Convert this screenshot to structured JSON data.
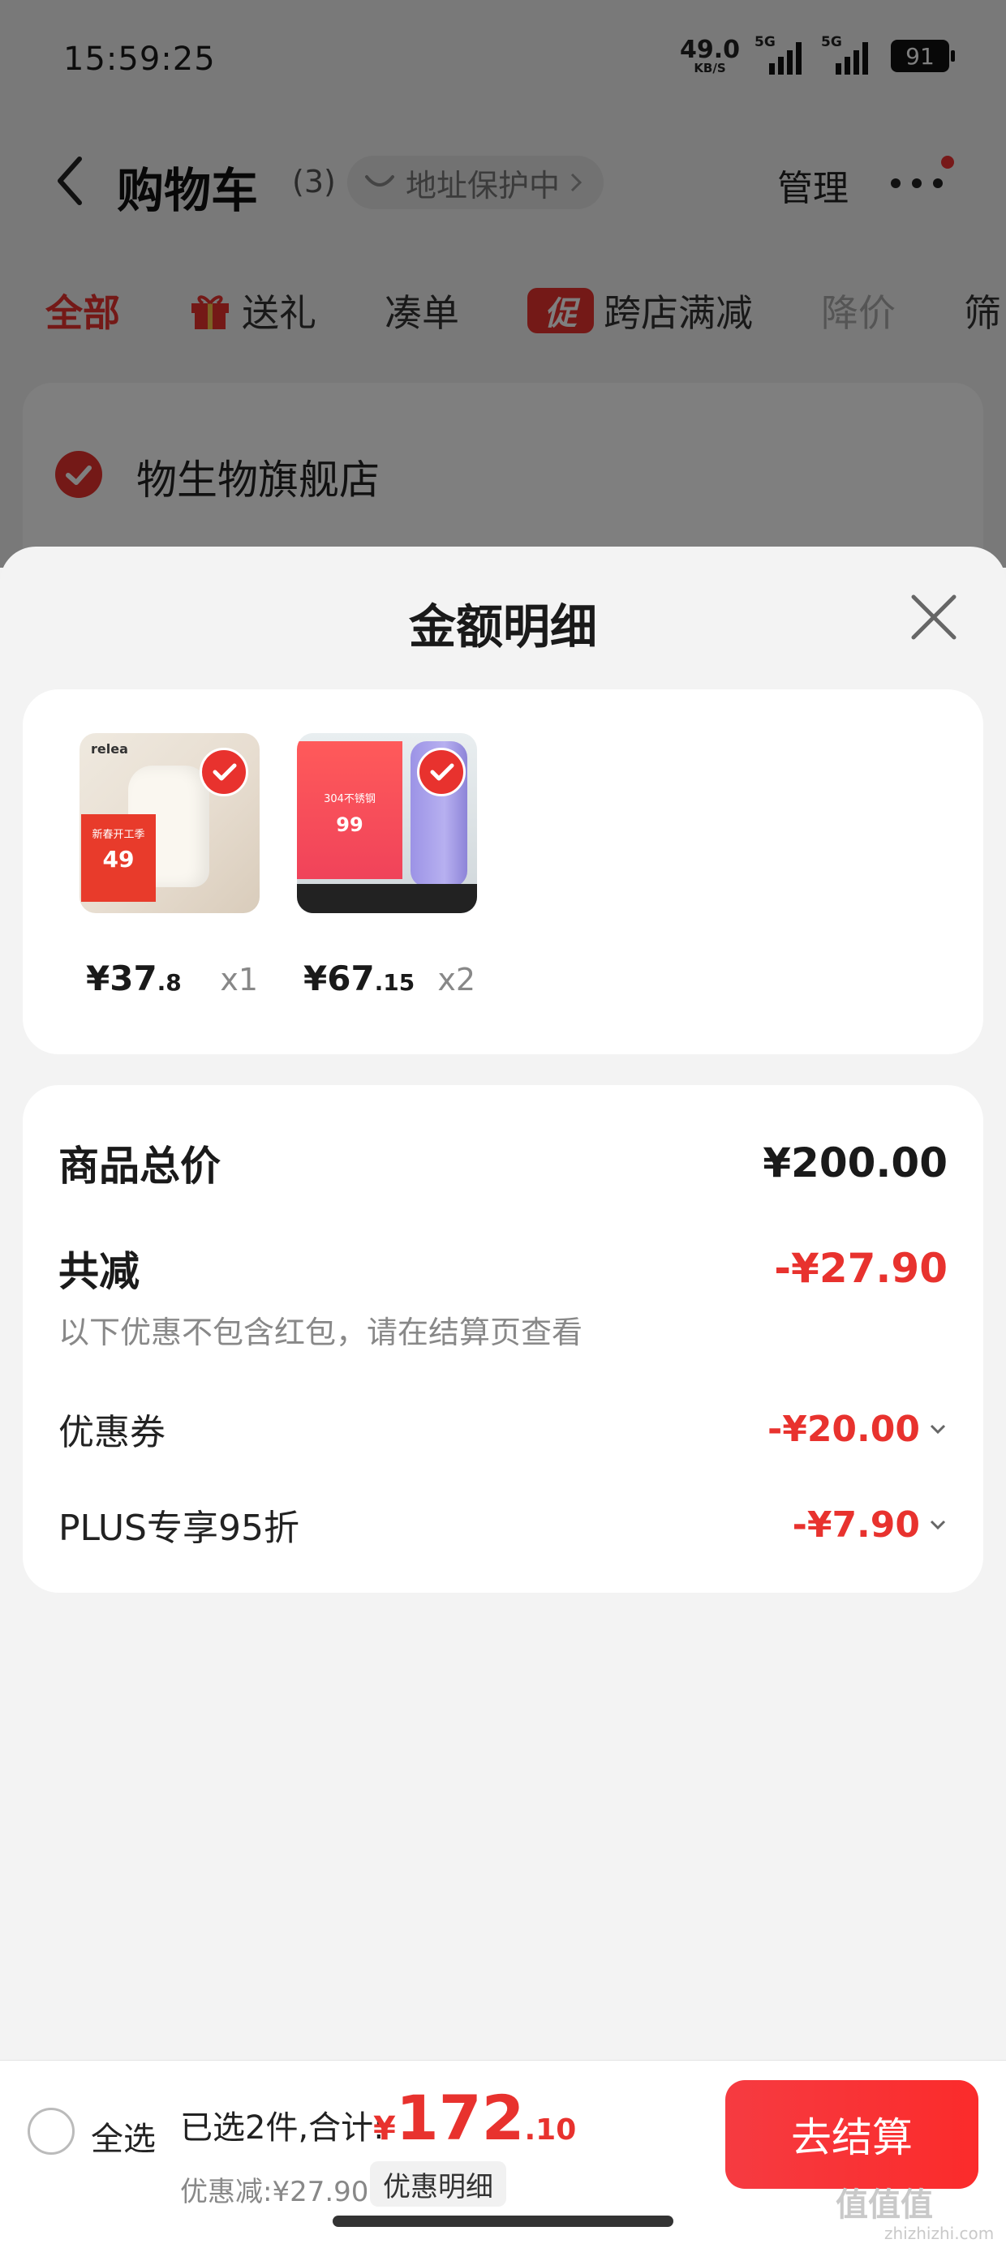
{
  "status_bar": {
    "time": "15:59:25",
    "net_speed": "49.0",
    "net_unit": "KB/S",
    "sim1": "5G",
    "sim2": "5G",
    "battery": "91"
  },
  "header": {
    "title": "购物车",
    "count": "(3)",
    "address_chip": "地址保护中",
    "manage": "管理"
  },
  "tabs": [
    "全部",
    "送礼",
    "凑单",
    "跨店满减",
    "降价",
    "筛"
  ],
  "store": {
    "name": "物生物旗舰店"
  },
  "sheet": {
    "title": "金额明细",
    "items": [
      {
        "price_int": "¥37",
        "price_dec": ".8",
        "qty": "x1",
        "thumb_brand": "relea",
        "thumb_tag": "新春开工季",
        "thumb_price": "49"
      },
      {
        "price_int": "¥67",
        "price_dec": ".15",
        "qty": "x2",
        "thumb_tag": "304不锈钢",
        "thumb_price": "99"
      }
    ],
    "summary": {
      "total_label": "商品总价",
      "total_value": "¥200.00",
      "reduce_label": "共减",
      "reduce_value": "-¥27.90",
      "note": "以下优惠不包含红包，请在结算页查看",
      "coupon_label": "优惠券",
      "coupon_value": "-¥20.00",
      "plus_label": "PLUS专享95折",
      "plus_value": "-¥7.90"
    }
  },
  "bottom_bar": {
    "select_all": "全选",
    "selected_text": "已选2件,合计:",
    "total_currency": "¥",
    "total_int": "172",
    "total_dec": ".10",
    "discount_text": "优惠减:¥27.90",
    "detail_button": "优惠明细",
    "checkout_button": "去结算"
  },
  "watermark": {
    "text": "值值值",
    "sub": "zhizhizhi.com"
  },
  "colors": {
    "accent": "#e8322e",
    "sheet_bg": "#f3f3f3"
  }
}
